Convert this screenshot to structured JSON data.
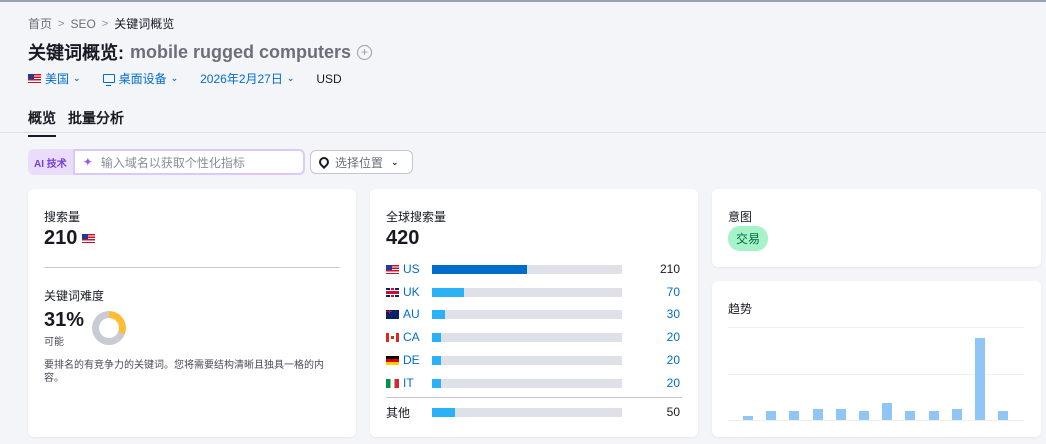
{
  "breadcrumb": {
    "home": "首页",
    "seo": "SEO",
    "current": "关键词概览",
    "sep": ">"
  },
  "title": {
    "prefix": "关键词概览:",
    "keyword": "mobile rugged computers",
    "add_symbol": "+"
  },
  "filters": {
    "country": "美国",
    "device": "桌面设备",
    "date": "2026年2月27日",
    "currency": "USD",
    "chevron": "⌄"
  },
  "tabs": [
    {
      "label": "概览",
      "active": true
    },
    {
      "label": "批量分析",
      "active": false
    }
  ],
  "ai": {
    "badge": "AI 技术",
    "placeholder": "输入域名以获取个性化指标"
  },
  "location": {
    "label": "选择位置"
  },
  "volume": {
    "label": "搜索量",
    "value": "210"
  },
  "difficulty": {
    "label": "关键词难度",
    "value": "31%",
    "level": "可能",
    "percent": 31,
    "description": "要排名的有竞争力的关键词。您将需要结构清晰且独具一格的内容。"
  },
  "global": {
    "label": "全球搜索量",
    "value": "420",
    "countries": [
      {
        "code": "US",
        "flag": "us-flag-icon",
        "value": "210",
        "share": 0.5
      },
      {
        "code": "UK",
        "flag": "uk-flag-icon",
        "value": "70",
        "share": 0.167
      },
      {
        "code": "AU",
        "flag": "au-flag-icon",
        "value": "30",
        "share": 0.071
      },
      {
        "code": "CA",
        "flag": "ca-flag-icon",
        "value": "20",
        "share": 0.048
      },
      {
        "code": "DE",
        "flag": "de-flag-icon",
        "value": "20",
        "share": 0.048
      },
      {
        "code": "IT",
        "flag": "it-flag-icon",
        "value": "20",
        "share": 0.048
      }
    ],
    "other": {
      "label": "其他",
      "value": "50",
      "share": 0.119
    }
  },
  "intent": {
    "label": "意图",
    "badge": "交易"
  },
  "trend": {
    "label": "趋势",
    "values": [
      4,
      10,
      10,
      12,
      12,
      10,
      18,
      10,
      10,
      12,
      88,
      10
    ]
  },
  "colors": {
    "accent": "#006dca",
    "bar_light": "#2bb1f7",
    "trend_bar": "#8fc6f5",
    "difficulty": "#ffbd35",
    "ai": "#7a3ed6"
  }
}
